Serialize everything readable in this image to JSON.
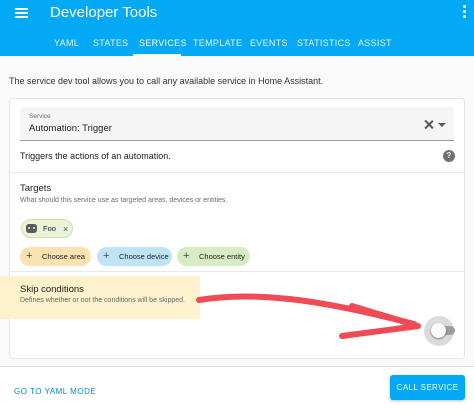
{
  "header": {
    "title": "Developer Tools",
    "menu_icon": "menu-icon",
    "more_icon": "more-vertical-icon",
    "background_color": "#03a9f4"
  },
  "tabs": [
    {
      "label": "YAML",
      "active": false
    },
    {
      "label": "STATES",
      "active": false
    },
    {
      "label": "SERVICES",
      "active": true
    },
    {
      "label": "TEMPLATE",
      "active": false
    },
    {
      "label": "EVENTS",
      "active": false
    },
    {
      "label": "STATISTICS",
      "active": false
    },
    {
      "label": "ASSIST",
      "active": false
    }
  ],
  "intro_text": "The service dev tool allows you to call any available service in Home Assistant.",
  "service": {
    "label": "Service",
    "value": "Automation: Trigger",
    "description": "Triggers the actions of an automation."
  },
  "targets": {
    "title": "Targets",
    "description": "What should this service use as targeted areas, devices or entities.",
    "selected": [
      {
        "label": "Foo",
        "icon": "robot-icon",
        "color": "#eaf3d9"
      }
    ],
    "buttons": [
      {
        "label": "Choose area",
        "icon": "plus-icon",
        "color": "#fce2b1"
      },
      {
        "label": "Choose device",
        "icon": "plus-icon",
        "color": "#c0e4f7"
      },
      {
        "label": "Choose entity",
        "icon": "plus-icon",
        "color": "#d7ecc4"
      }
    ]
  },
  "skip_conditions": {
    "title": "Skip conditions",
    "description": "Defines whether or not the conditions will be skipped.",
    "enabled": false,
    "highlight_color": "#fdf1c5",
    "annotation_arrow_color": "#ef4b55"
  },
  "footer": {
    "yaml_mode_label": "GO TO YAML MODE",
    "call_service_label": "CALL SERVICE"
  }
}
